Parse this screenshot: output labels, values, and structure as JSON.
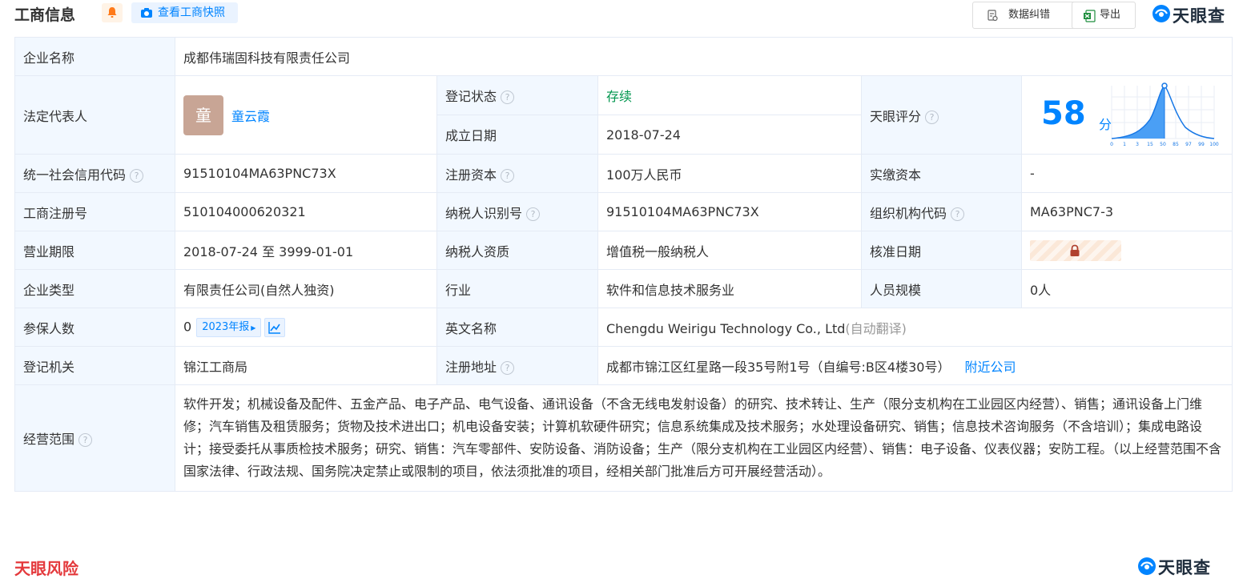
{
  "header": {
    "title": "工商信息",
    "snapshot_button": "查看工商快照",
    "correct_button": "数据纠错",
    "export_button": "导出",
    "logo_text": "天眼查"
  },
  "labels": {
    "company_name": "企业名称",
    "legal_rep": "法定代表人",
    "reg_status": "登记状态",
    "founded": "成立日期",
    "score": "天眼评分",
    "credit_code": "统一社会信用代码",
    "reg_capital": "注册资本",
    "paid_capital": "实缴资本",
    "reg_no": "工商注册号",
    "taxpayer_id": "纳税人识别号",
    "org_code": "组织机构代码",
    "term": "营业期限",
    "taxpayer_type": "纳税人资质",
    "approval_date": "核准日期",
    "company_type": "企业类型",
    "industry": "行业",
    "staff_size": "人员规模",
    "insured": "参保人数",
    "english_name": "英文名称",
    "authority": "登记机关",
    "address": "注册地址",
    "scope": "经营范围"
  },
  "values": {
    "company_name": "成都伟瑞固科技有限责任公司",
    "legal_rep_avatar": "童",
    "legal_rep": "童云霞",
    "reg_status": "存续",
    "founded": "2018-07-24",
    "score": "58",
    "score_unit": "分",
    "credit_code": "91510104MA63PNC73X",
    "reg_capital": "100万人民币",
    "paid_capital": "-",
    "reg_no": "510104000620321",
    "taxpayer_id": "91510104MA63PNC73X",
    "org_code": "MA63PNC7-3",
    "term": "2018-07-24 至 3999-01-01",
    "taxpayer_type": "增值税一般纳税人",
    "company_type": "有限责任公司(自然人独资)",
    "industry": "软件和信息技术服务业",
    "staff_size": "0人",
    "insured": "0",
    "insured_year": "2023年报",
    "english_name": "Chengdu Weirigu Technology Co., Ltd",
    "english_note": "(自动翻译)",
    "authority": "锦江工商局",
    "address": "成都市锦江区红星路一段35号附1号（自编号:B区4楼30号）",
    "nearby": "附近公司",
    "scope": "软件开发；机械设备及配件、五金产品、电子产品、电气设备、通讯设备（不含无线电发射设备）的研究、技术转让、生产（限分支机构在工业园区内经营）、销售；通讯设备上门维修；汽车销售及租赁服务；货物及技术进出口；机电设备安装；计算机软硬件研究；信息系统集成及技术服务；水处理设备研究、销售；信息技术咨询服务（不含培训）；集成电路设计；接受委托从事质检技术服务；研究、销售：汽车零部件、安防设备、消防设备；生产（限分支机构在工业园区内经营）、销售：电子设备、仪表仪器；安防工程。（以上经营范围不含国家法律、行政法规、国务院决定禁止或限制的项目，依法须批准的项目，经相关部门批准后方可开展经营活动）。"
  },
  "score_chart": {
    "x_ticks": [
      "0",
      "1",
      "3",
      "15",
      "50",
      "85",
      "97",
      "99",
      "100"
    ]
  },
  "footer": {
    "title": "天眼风险",
    "logo_text": "天眼查"
  },
  "colors": {
    "accent": "#0084ff",
    "label_bg": "#f2f8ff",
    "status_green": "#00964e",
    "risk_red": "#e4393c"
  }
}
